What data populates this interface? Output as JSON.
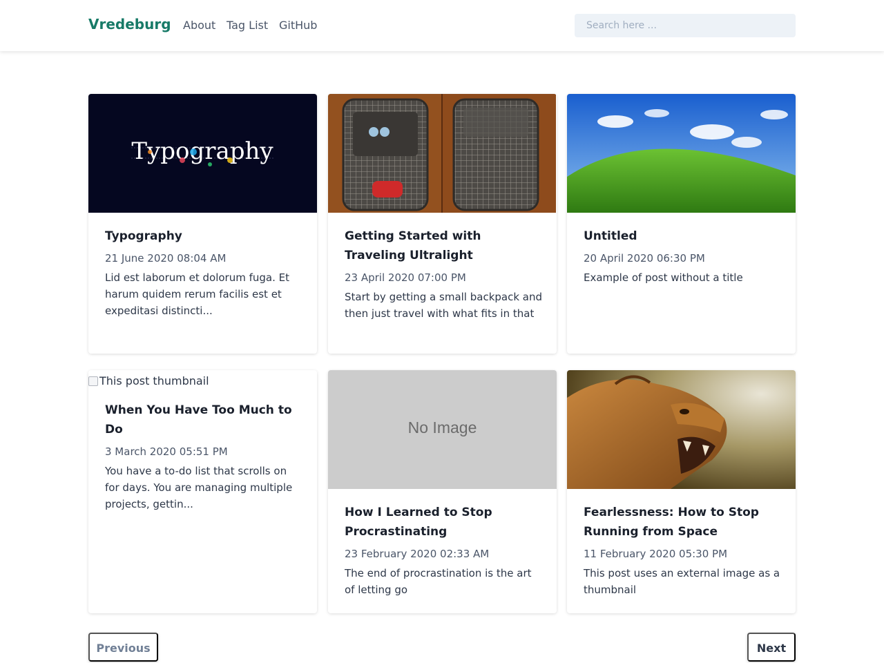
{
  "nav": {
    "brand": "Vredeburg",
    "links": [
      "About",
      "Tag List",
      "GitHub"
    ],
    "search_placeholder": "Search here ..."
  },
  "posts": [
    {
      "title": "Typography",
      "date": "21 June 2020 08:04 AM",
      "summary": "Lid est laborum et dolorum fuga. Et harum quidem rerum facilis est et expeditasi distincti...",
      "thumbnail_text": "Typography"
    },
    {
      "title": "Getting Started with Traveling Ultralight",
      "date": "23 April 2020 07:00 PM",
      "summary": "Start by getting a small backpack and then just travel with what fits in that"
    },
    {
      "title": "Untitled",
      "date": "20 April 2020 06:30 PM",
      "summary": "Example of post without a title"
    },
    {
      "title": "When You Have Too Much to Do",
      "date": "3 March 2020 05:51 PM",
      "summary": "You have a to-do list that scrolls on for days. You are managing multiple projects, gettin...",
      "thumbnail_alt": "This post thumbnail"
    },
    {
      "title": "How I Learned to Stop Procrastinating",
      "date": "23 February 2020 02:33 AM",
      "summary": "The end of procrastination is the art of letting go",
      "thumbnail_text": "No Image"
    },
    {
      "title": "Fearlessness: How to Stop Running from Space",
      "date": "11 February 2020 05:30 PM",
      "summary": "This post uses an external image as a thumbnail"
    }
  ],
  "pagination": {
    "previous": "Previous",
    "next": "Next"
  },
  "colors": {
    "brand": "#177a67",
    "text": "#1a202c",
    "muted": "#4a5568",
    "search_bg": "#edf2f7"
  }
}
